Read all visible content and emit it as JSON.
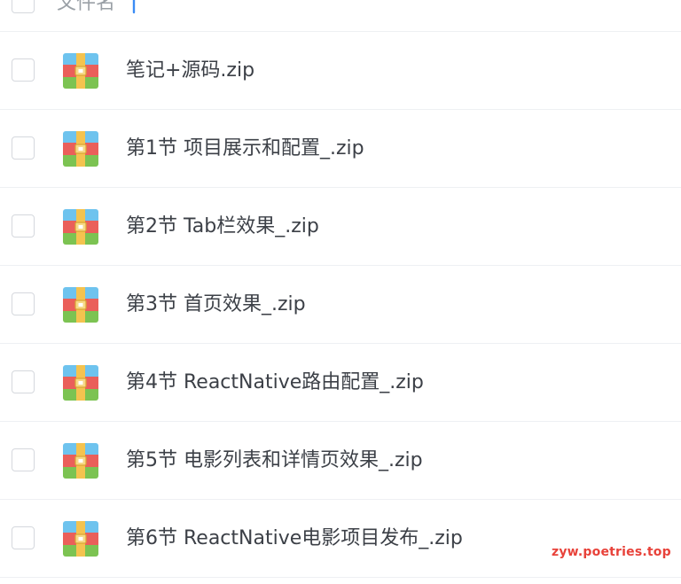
{
  "header": {
    "label": "文件名",
    "sort_icon": "arrow-up-icon"
  },
  "files": [
    {
      "name": "笔记+源码.zip",
      "icon": "zip-archive-icon"
    },
    {
      "name": "第1节 项目展示和配置_.zip",
      "icon": "zip-archive-icon"
    },
    {
      "name": "第2节 Tab栏效果_.zip",
      "icon": "zip-archive-icon"
    },
    {
      "name": "第3节 首页效果_.zip",
      "icon": "zip-archive-icon"
    },
    {
      "name": "第4节 ReactNative路由配置_.zip",
      "icon": "zip-archive-icon"
    },
    {
      "name": "第5节 电影列表和详情页效果_.zip",
      "icon": "zip-archive-icon"
    },
    {
      "name": "第6节 ReactNative电影项目发布_.zip",
      "icon": "zip-archive-icon"
    }
  ],
  "watermark": "zyw.poetries.top",
  "colors": {
    "accent": "#3b8cf5",
    "text": "#3c4047",
    "muted": "#9aa0a6",
    "divider": "#eef0f3",
    "watermark": "#e8423a"
  }
}
